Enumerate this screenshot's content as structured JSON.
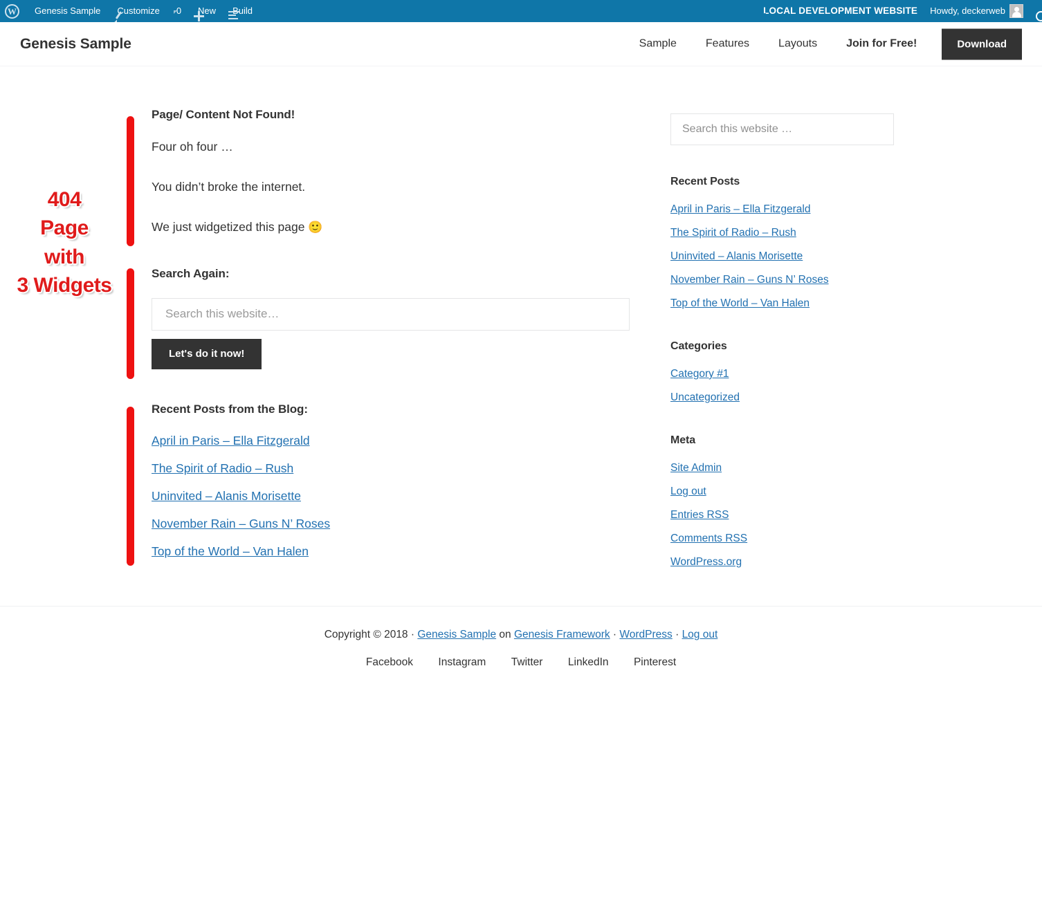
{
  "adminbar": {
    "left_items": [
      {
        "label": "",
        "icon": "wordpress-logo-icon"
      },
      {
        "label": "Genesis Sample",
        "icon": "dashboard-gauge-icon"
      },
      {
        "label": "Customize",
        "icon": "pencil-icon"
      },
      {
        "label": "0",
        "icon": "comment-bubble-icon"
      },
      {
        "label": "New",
        "icon": "plus-icon"
      },
      {
        "label": "Build",
        "icon": "build-list-icon"
      }
    ],
    "notice": "LOCAL DEVELOPMENT WEBSITE",
    "notice_icon": "warning-circle-icon",
    "howdy": "Howdy, deckerweb",
    "avatar_icon": "user-avatar-icon",
    "search_icon": "search-icon",
    "background_color": "#0f76a8"
  },
  "header": {
    "site_title": "Genesis Sample",
    "nav": [
      {
        "label": "Sample",
        "bold": false
      },
      {
        "label": "Features",
        "bold": false
      },
      {
        "label": "Layouts",
        "bold": false
      },
      {
        "label": "Join for Free!",
        "bold": true
      }
    ],
    "download_button": "Download"
  },
  "annotation": {
    "text": "404 Page with 3 Widgets",
    "lines": [
      "404",
      "Page",
      "with",
      "3 Widgets"
    ],
    "color": "#e01b1b"
  },
  "content": {
    "widget_404": {
      "title": "Page/ Content Not Found!",
      "paragraphs": [
        "Four oh four …",
        "You didn’t broke the internet.",
        "We just widgetized this page"
      ],
      "emoji": "🙂"
    },
    "widget_search": {
      "title": "Search Again:",
      "placeholder": "Search this website…",
      "value": "",
      "submit_label": "Let's do it now!"
    },
    "widget_recent": {
      "title": "Recent Posts from the Blog:",
      "links": [
        "April in Paris – Ella Fitzgerald",
        "The Spirit of Radio – Rush",
        "Uninvited – Alanis Morisette",
        "November Rain – Guns N’ Roses",
        "Top of the World – Van Halen"
      ]
    }
  },
  "sidebar": {
    "search": {
      "placeholder": "Search this website …",
      "value": ""
    },
    "recent_posts": {
      "title": "Recent Posts",
      "links": [
        "April in Paris – Ella Fitzgerald",
        "The Spirit of Radio – Rush",
        "Uninvited – Alanis Morisette",
        "November Rain – Guns N’ Roses",
        "Top of the World – Van Halen"
      ]
    },
    "categories": {
      "title": "Categories",
      "links": [
        "Category #1",
        "Uncategorized"
      ]
    },
    "meta": {
      "title": "Meta",
      "links": [
        "Site Admin",
        "Log out",
        "Entries RSS",
        "Comments RSS",
        "WordPress.org"
      ]
    }
  },
  "footer": {
    "credits": {
      "prefix": "Copyright © 2018 · ",
      "link1": "Genesis Sample",
      "mid1": " on ",
      "link2": "Genesis Framework",
      "mid2": " · ",
      "link3": "WordPress",
      "mid3": " · ",
      "link4": "Log out"
    },
    "social": [
      "Facebook",
      "Instagram",
      "Twitter",
      "LinkedIn",
      "Pinterest"
    ]
  }
}
